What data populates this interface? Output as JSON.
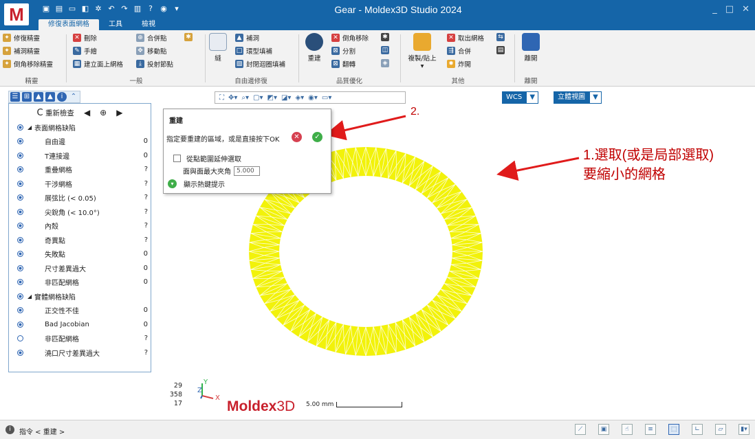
{
  "app": {
    "logo": "M",
    "title": "Gear - Moldex3D Studio 2024"
  },
  "qat_icons": [
    "save-icon",
    "new-icon",
    "open-icon",
    "import-icon",
    "settings-icon",
    "undo-icon",
    "redo-icon",
    "help-icon",
    "info-icon",
    "camera-icon"
  ],
  "tabs": [
    {
      "label": "修復表面網格",
      "active": true
    },
    {
      "label": "工具",
      "active": false
    },
    {
      "label": "檢視",
      "active": false
    }
  ],
  "ribbon": {
    "g1": {
      "items": [
        "修復精靈",
        "補洞精靈",
        "倒角移除精靈"
      ],
      "label": "精靈"
    },
    "g2": {
      "items": [
        "刪除",
        "手繪",
        "建立面上網格",
        "合併點",
        "移動點",
        "投射節點"
      ],
      "label": "一般"
    },
    "g3": {
      "big": "縫",
      "items": [
        "補洞",
        "環型填補",
        "封閉迴圈填補"
      ],
      "label": "自由邊修復"
    },
    "g4": {
      "big": "重建",
      "items": [
        "倒角移除",
        "分割",
        "翻轉"
      ],
      "label": "品質優化"
    },
    "g5": {
      "big": "複製/貼上",
      "items": [
        "取出網格",
        "合併",
        "炸開"
      ],
      "label": "其他"
    },
    "g6": {
      "big": "離開",
      "label": "離開"
    }
  },
  "view": {
    "wcs": "WCS",
    "iso": "立體視圖"
  },
  "panel": {
    "recheck": "重新檢查",
    "rows": [
      {
        "type": "section",
        "name": "表面網格缺陷",
        "count": ""
      },
      {
        "name": "自由邊",
        "count": "0"
      },
      {
        "name": "T連接邊",
        "count": "0"
      },
      {
        "name": "重疊網格",
        "count": "?"
      },
      {
        "name": "干涉網格",
        "count": "?"
      },
      {
        "name": "展弦比 (< 0.05)",
        "count": "?"
      },
      {
        "name": "尖銳角 (< 10.0°)",
        "count": "?"
      },
      {
        "name": "內殼",
        "count": "?"
      },
      {
        "name": "奇異點",
        "count": "?"
      },
      {
        "name": "失敗點",
        "count": "0"
      },
      {
        "name": "尺寸差異過大",
        "count": "0"
      },
      {
        "name": "非匹配網格",
        "count": "0"
      },
      {
        "type": "section",
        "name": "實體網格缺陷",
        "count": ""
      },
      {
        "name": "正交性不佳",
        "count": "0"
      },
      {
        "name": "Bad Jacobian",
        "count": "0",
        "off": false
      },
      {
        "name": "非匹配網格",
        "count": "?",
        "off": true
      },
      {
        "name": "澆口尺寸差異過大",
        "count": "?"
      }
    ]
  },
  "dialog": {
    "title": "重建",
    "instruction": "指定要重建的區域，或是直接按下OK",
    "extend_label": "從點範圍延伸選取",
    "angle_label": "面與面最大夾角",
    "angle_value": "5.000",
    "hint_label": "顯示熱鍵提示"
  },
  "annotations": {
    "a1_line1": "1.選取(或是局部選取)",
    "a1_line2": "要縮小的網格",
    "a2": "2."
  },
  "colors": {
    "mesh": "#f2f20a",
    "arrow": "#e01b1b",
    "brand": "#c8202c",
    "titlebar": "#1565a8"
  },
  "viewport": {
    "counts": [
      "29",
      "358",
      "17"
    ],
    "axis_y": "Y",
    "axis_z": "Z",
    "axis_x": "X",
    "brand_a": "Moldex",
    "brand_b": "3D",
    "scale": "5.00 mm"
  },
  "status": {
    "text": "指令 < 重建 >"
  }
}
